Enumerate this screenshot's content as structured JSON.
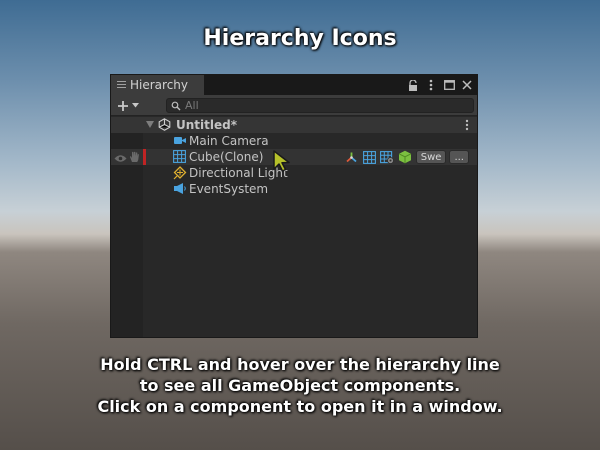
{
  "headline": "Hierarchy Icons",
  "caption_lines": [
    "Hold CTRL and hover over the hierarchy line",
    "to see all GameObject components.",
    "Click on a component to open it in a window."
  ],
  "window": {
    "tab_label": "Hierarchy",
    "search_placeholder": "All",
    "scene_name": "Untitled*",
    "objects": [
      {
        "name": "Main Camera",
        "icon": "camera-icon"
      },
      {
        "name": "Cube(Clone)",
        "icon": "grid-mesh-icon"
      },
      {
        "name": "Directional Light",
        "icon": "light-icon"
      },
      {
        "name": "EventSystem",
        "icon": "megaphone-icon"
      }
    ],
    "component_pills": {
      "swe": "Swe",
      "more": "..."
    }
  },
  "colors": {
    "panel": "#282828",
    "toolbar": "#3c3c3c",
    "text": "#c4c4c4",
    "accent_blue": "#4aa3df",
    "marker_red": "#c02424",
    "cube_green": "#7cc040",
    "cursor_yellow": "#b6c12a"
  }
}
